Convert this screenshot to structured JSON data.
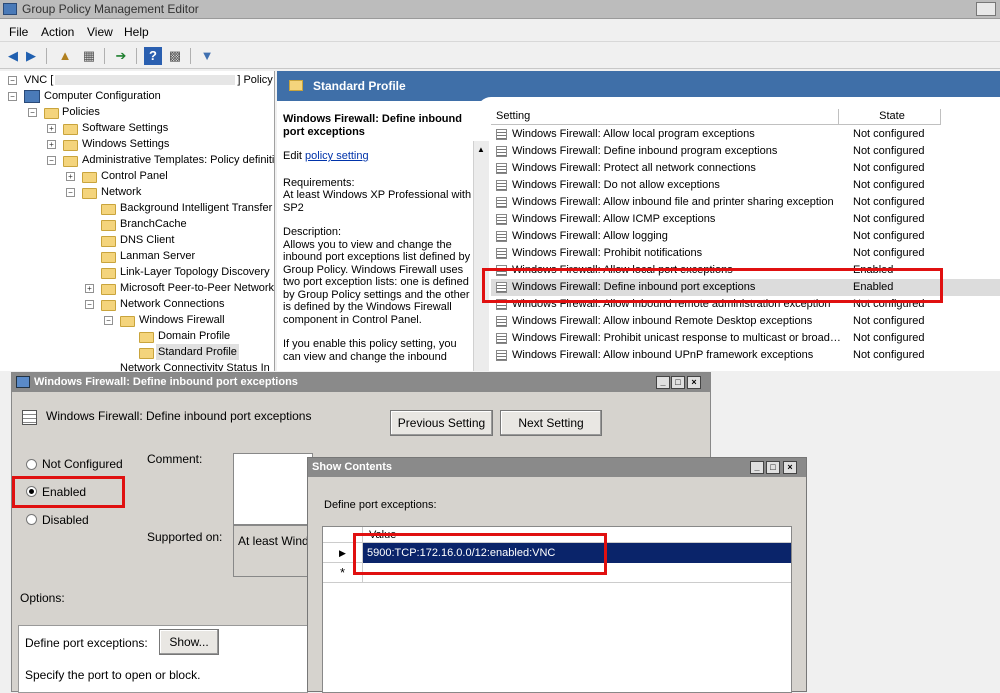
{
  "window": {
    "title": "Group Policy Management Editor"
  },
  "menu": [
    "File",
    "Action",
    "View",
    "Help"
  ],
  "tree": {
    "root": "VNC [",
    "root_suffix": "] Policy",
    "items": [
      "Computer Configuration",
      "Policies",
      "Software Settings",
      "Windows Settings",
      "Administrative Templates: Policy definiti",
      "Control Panel",
      "Network",
      "Background Intelligent Transfer",
      "BranchCache",
      "DNS Client",
      "Lanman Server",
      "Link-Layer Topology Discovery",
      "Microsoft Peer-to-Peer Network",
      "Network Connections",
      "Windows Firewall",
      "Domain Profile",
      "Standard Profile",
      "Network Connectivity Status In"
    ]
  },
  "header": {
    "title": "Standard Profile"
  },
  "desc": {
    "title": "Windows Firewall: Define inbound port exceptions",
    "edit_prefix": "Edit ",
    "edit_link": "policy setting",
    "req_label": "Requirements:",
    "req_text": "At least Windows XP Professional with SP2",
    "desc_label": "Description:",
    "desc_text": "Allows you to view and change the inbound port exceptions list defined by Group Policy. Windows Firewall uses two port exception lists: one is defined by Group Policy settings and the other is defined by the Windows Firewall component in Control Panel.",
    "desc_text2": "If you enable this policy setting, you can view and change the inbound"
  },
  "list": {
    "col_setting": "Setting",
    "col_state": "State",
    "rows": [
      {
        "s": "Windows Firewall: Allow local program exceptions",
        "st": "Not configured"
      },
      {
        "s": "Windows Firewall: Define inbound program exceptions",
        "st": "Not configured"
      },
      {
        "s": "Windows Firewall: Protect all network connections",
        "st": "Not configured"
      },
      {
        "s": "Windows Firewall: Do not allow exceptions",
        "st": "Not configured"
      },
      {
        "s": "Windows Firewall: Allow inbound file and printer sharing exception",
        "st": "Not configured"
      },
      {
        "s": "Windows Firewall: Allow ICMP exceptions",
        "st": "Not configured"
      },
      {
        "s": "Windows Firewall: Allow logging",
        "st": "Not configured"
      },
      {
        "s": "Windows Firewall: Prohibit notifications",
        "st": "Not configured"
      },
      {
        "s": "Windows Firewall: Allow local port exceptions",
        "st": "Enabled"
      },
      {
        "s": "Windows Firewall: Define inbound port exceptions",
        "st": "Enabled"
      },
      {
        "s": "Windows Firewall: Allow inbound remote administration exception",
        "st": "Not configured"
      },
      {
        "s": "Windows Firewall: Allow inbound Remote Desktop exceptions",
        "st": "Not configured"
      },
      {
        "s": "Windows Firewall: Prohibit unicast response to multicast or broad…",
        "st": "Not configured"
      },
      {
        "s": "Windows Firewall: Allow inbound UPnP framework exceptions",
        "st": "Not configured"
      }
    ]
  },
  "dialog": {
    "title": "Windows Firewall: Define inbound port exceptions",
    "setting_name": "Windows Firewall: Define inbound port exceptions",
    "prev": "Previous Setting",
    "next": "Next Setting",
    "not_configured": "Not Configured",
    "enabled": "Enabled",
    "disabled": "Disabled",
    "comment": "Comment:",
    "supported_on": "Supported on:",
    "supported_value": "At least Wind",
    "options": "Options:",
    "define_label": "Define port exceptions:",
    "show_btn": "Show...",
    "specify": "Specify the port to open or block."
  },
  "show_contents": {
    "title": "Show Contents",
    "prompt": "Define port exceptions:",
    "col_value": "Value",
    "rows": [
      "5900:TCP:172.16.0.0/12:enabled:VNC"
    ],
    "new_row_marker": "*"
  },
  "colors": {
    "highlight": "#e01010",
    "header_band": "#3f6fa8",
    "selected_row": "#0a246a"
  }
}
